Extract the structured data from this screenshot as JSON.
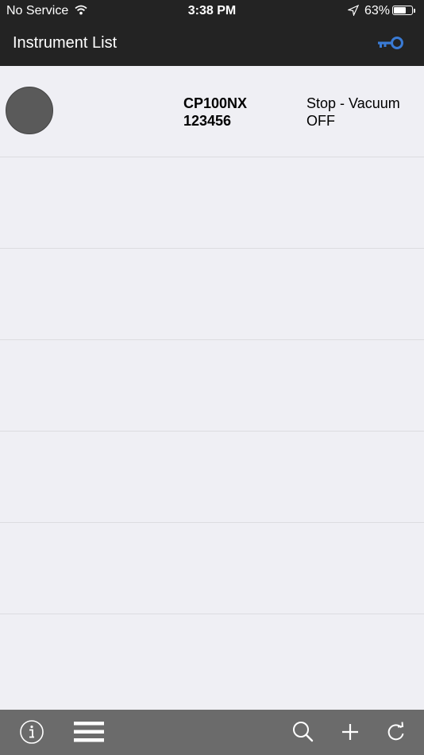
{
  "status_bar": {
    "carrier": "No Service",
    "time": "3:38 PM",
    "battery_percent": "63%",
    "battery_level": 0.63
  },
  "nav": {
    "title": "Instrument List",
    "key_icon": "key-icon",
    "key_color": "#3a7bd5"
  },
  "instruments": [
    {
      "model": "CP100NX",
      "serial": "123456",
      "state_line1": "Stop - Vacuum",
      "state_line2": "OFF"
    }
  ],
  "toolbar": {
    "icons": [
      "info-icon",
      "menu-icon",
      "search-icon",
      "add-icon",
      "refresh-icon"
    ]
  }
}
